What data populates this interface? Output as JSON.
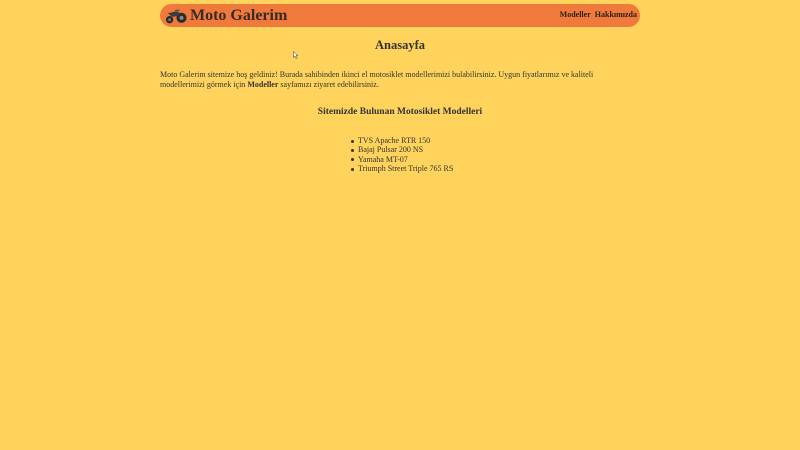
{
  "header": {
    "logo_icon": "motorcycle-icon",
    "logo_text": "Moto Galerim",
    "nav": [
      {
        "label": "Modeller"
      },
      {
        "label": "Hakkımızda"
      }
    ]
  },
  "main": {
    "page_title": "Anasayfa",
    "intro_before": "Moto Galerim sitemize hoş geldiniz! Burada sahibinden ikinci el motosiklet modellerimizi bulabilirsiniz. Uygun fiyatlarımız ve kaliteli modellerimizi görmek için ",
    "intro_link": "Modeller",
    "intro_after": " sayfamızı ziyaret edebilirsiniz.",
    "section_title": "Sitemizde Bulunan Motosiklet Modelleri",
    "models": [
      "TVS Apache RTR 150",
      "Bajaj Pulsar 200 NS",
      "Yamaha MT-07",
      "Triumph Street Triple 765 RS"
    ]
  },
  "colors": {
    "background": "#ffd35c",
    "header": "#ef7a3c",
    "text": "#333333"
  }
}
